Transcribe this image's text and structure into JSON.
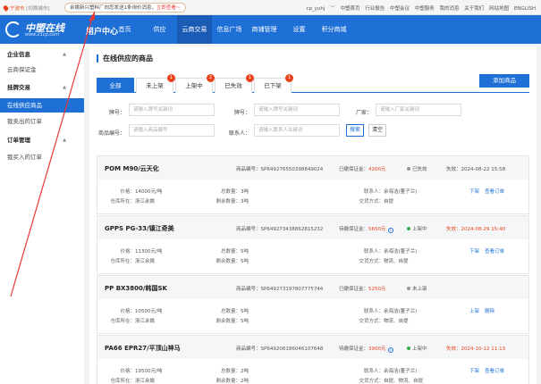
{
  "topbar": {
    "city": "宁波市",
    "city_sub": "[切换城市]",
    "notice_text": "余姚新兴塑料厂向您发送1条询价消息，",
    "notice_link": "立即查看~",
    "user": "cp_yuhj",
    "links": [
      "中塑首页",
      "行业报告",
      "中塑会议",
      "中塑服务",
      "我的消息",
      "关于我们",
      "网站地图",
      "ENGLISH"
    ]
  },
  "nav": {
    "logo_text": "中塑在线",
    "logo_url": "www.21cp.com",
    "user_center": "用户中心",
    "items": [
      "首页",
      "供应",
      "云商交易",
      "信息广场",
      "商铺管理",
      "设置",
      "积分商城"
    ],
    "active_index": 2
  },
  "sidebar": {
    "groups": [
      {
        "title": "企业信息",
        "items": [
          "云商保证金"
        ]
      },
      {
        "title": "挂牌交易",
        "items": [
          "在线供应商品",
          "我卖出的订单"
        ]
      },
      {
        "title": "订单管理",
        "items": [
          "我买入的订单"
        ]
      }
    ],
    "active_item": "在线供应商品"
  },
  "page": {
    "title": "在线供应的商品",
    "add_button": "添加商品",
    "tabs": [
      {
        "label": "全部",
        "badge": ""
      },
      {
        "label": "未上架",
        "badge": "1"
      },
      {
        "label": "上架中",
        "badge": "2"
      },
      {
        "label": "已失效",
        "badge": "1"
      },
      {
        "label": "已下架",
        "badge": "1"
      }
    ]
  },
  "filters": {
    "grade_label": "牌号：",
    "grade_placeholder": "请输入牌号关键词",
    "brand_label": "牌号：",
    "brand_placeholder": "请输入牌号关键词",
    "factory_label": "厂家：",
    "factory_placeholder": "请输入厂家关键词",
    "code_label": "商品编号：",
    "code_placeholder": "请输入商品编号",
    "contact_label": "联系人：",
    "contact_placeholder": "请输入联系人关键词",
    "search_button": "搜索",
    "clear_button": "清空"
  },
  "labels": {
    "code": "商品编号：",
    "deposit_paid": "已缴保证金：",
    "deposit_pending": "待缴保证金：",
    "price": "价格：",
    "total": "总数量：",
    "remain": "剩余数量：",
    "contact": "联系人：",
    "delivery": "交货方式：",
    "location": "仓库所在：",
    "expire": "失效："
  },
  "products": [
    {
      "name": "POM M90/云天化",
      "code": "SP649276550398849024",
      "deposit_label_key": "deposit_paid",
      "deposit": "4200元",
      "status": "已失效",
      "status_color": "#999999",
      "expire": "2024-08-22 15:58",
      "expire_red": false,
      "price": "14000元/吨",
      "total": "3吨",
      "remain": "3吨",
      "contact": "余海洁(董子兰)",
      "delivery": "自提",
      "location": "浙江余姚",
      "actions": [
        "下架",
        "查看订单"
      ]
    },
    {
      "name": "GPPS PG-33/镇江奇美",
      "code": "SP649273438862815232",
      "deposit_label_key": "deposit_pending",
      "deposit": "5650元",
      "status": "上架中",
      "status_color": "#2bb24c",
      "expire": "2024-08-29 15:40",
      "expire_red": true,
      "price": "11300元/吨",
      "total": "5吨",
      "remain": "5吨",
      "contact": "余海洁(董子兰)",
      "delivery": "物流、自提",
      "location": "浙江余姚",
      "actions": [
        "下架",
        "查看订单"
      ]
    },
    {
      "name": "PP BX3800/韩国SK",
      "code": "SP649273197807775744",
      "deposit_label_key": "deposit_paid",
      "deposit": "5250元",
      "status": "未上架",
      "status_color": "#999999",
      "expire": "",
      "expire_red": false,
      "price": "10500元/吨",
      "total": "5吨",
      "remain": "5吨",
      "contact": "余海洁(董子兰)",
      "delivery": "物流、自提",
      "location": "浙江余姚",
      "actions": [
        "上架",
        "删除"
      ]
    },
    {
      "name": "PA66 EPR27/平顶山神马",
      "code": "SP649206186046107648",
      "deposit_label_key": "deposit_pending",
      "deposit": "3900元",
      "status": "上架中",
      "status_color": "#2bb24c",
      "expire": "2024-10-12 11:13",
      "expire_red": true,
      "price": "19500元/吨",
      "total": "2吨",
      "remain": "2吨",
      "contact": "余海洁(董子兰)",
      "delivery": "自提、物流、自提",
      "location": "浙江余姚",
      "actions": [
        "下架",
        "查看订单"
      ]
    }
  ],
  "colors": {
    "primary": "#1e6fd6",
    "red": "#e8421c",
    "green": "#2bb24c",
    "annotation_arrow": "#e53935"
  }
}
